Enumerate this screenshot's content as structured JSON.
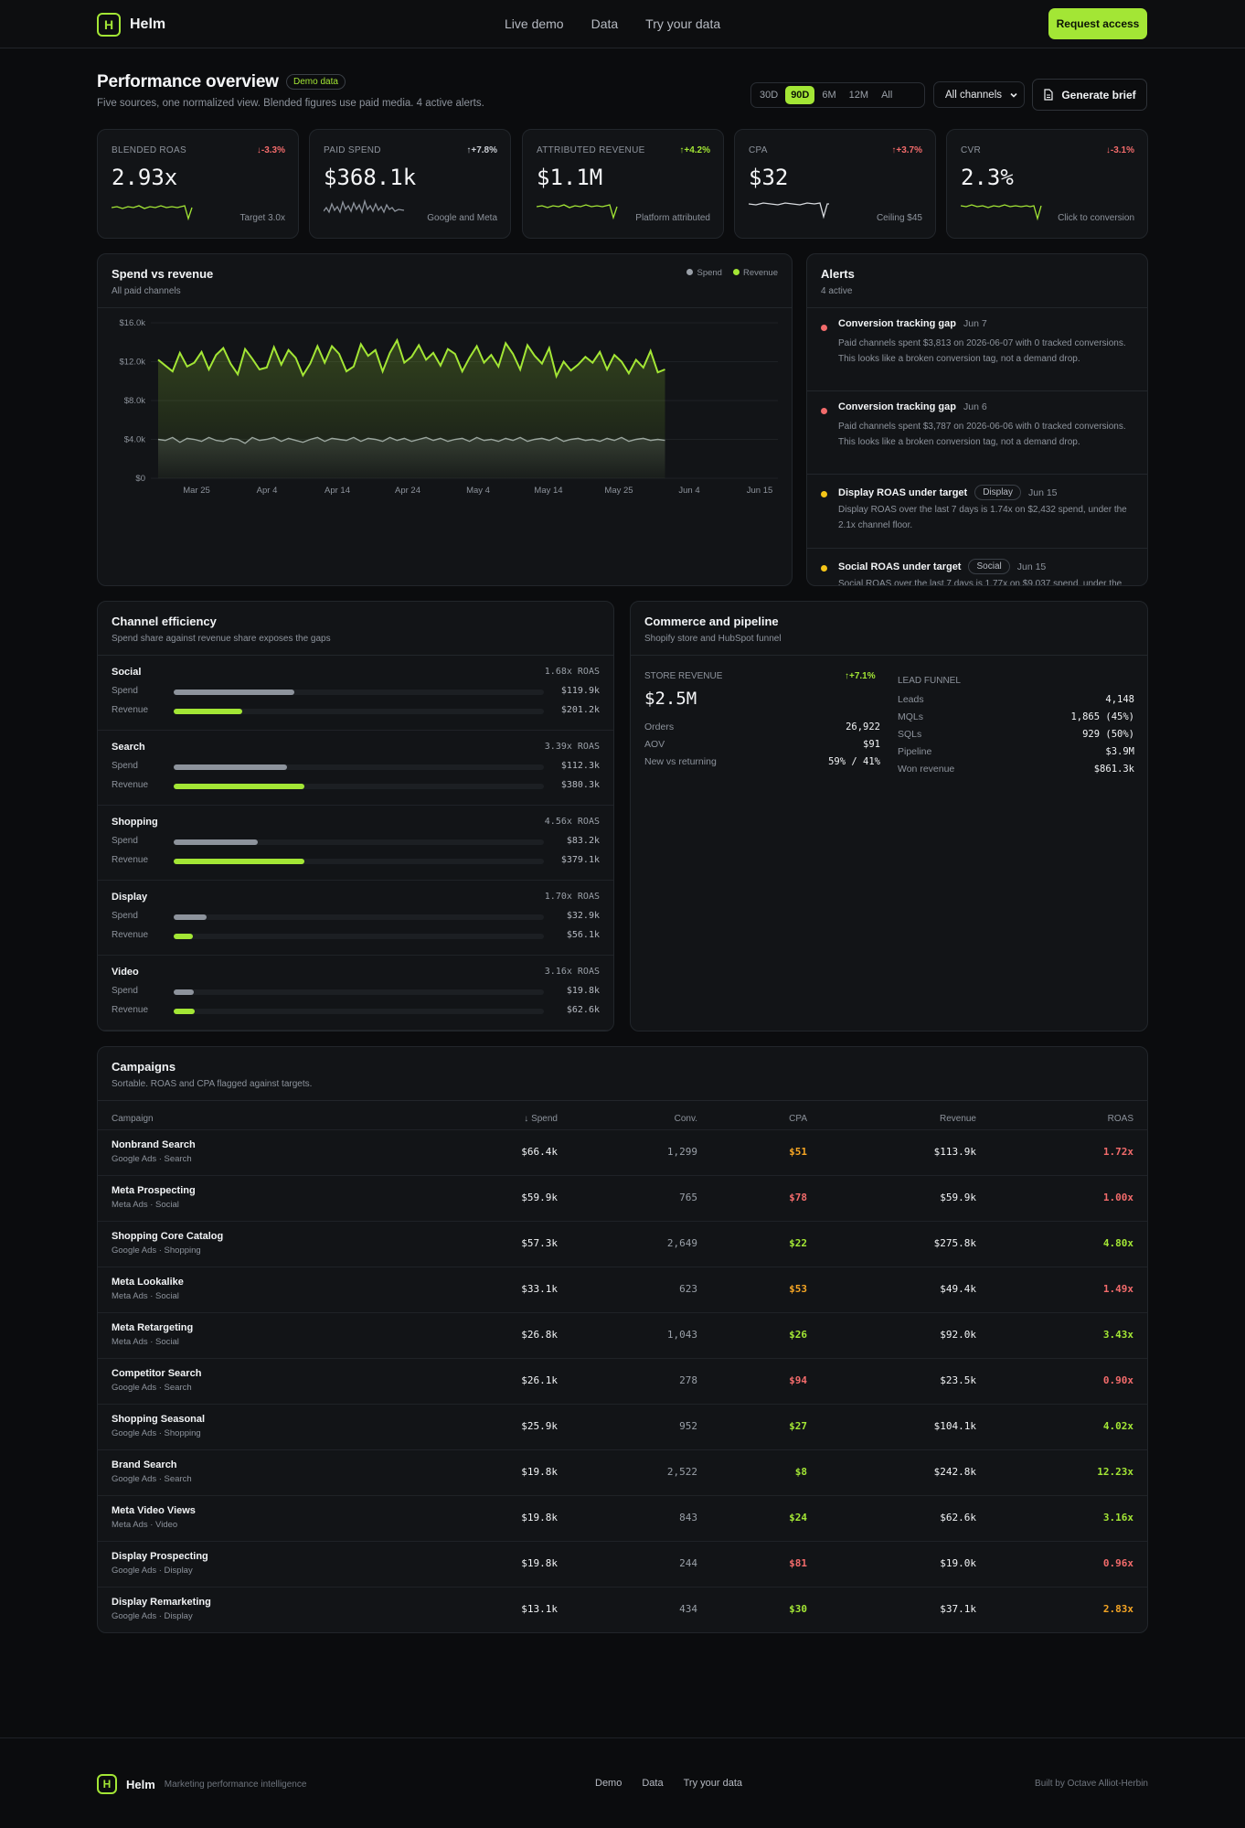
{
  "nav": {
    "brand": "Helm",
    "links": [
      "Live demo",
      "Data",
      "Try your data"
    ],
    "cta": "Request access"
  },
  "header": {
    "title": "Performance overview",
    "badge": "Demo data",
    "subtitle": "Five sources, one normalized view. Blended figures use paid media. 4 active alerts.",
    "ranges": [
      "30D",
      "90D",
      "6M",
      "12M",
      "All"
    ],
    "active_range": "90D",
    "channel_select": "All channels",
    "generate": "Generate brief"
  },
  "kpis": [
    {
      "label": "BLENDED ROAS",
      "delta": "↓-3.3%",
      "dir": "down",
      "value": "2.93x",
      "note": "Target 3.0x"
    },
    {
      "label": "PAID SPEND",
      "delta": "↑+7.8%",
      "dir": "neutral",
      "value": "$368.1k",
      "note": "Google and Meta"
    },
    {
      "label": "ATTRIBUTED REVENUE",
      "delta": "↑+4.2%",
      "dir": "up",
      "value": "$1.1M",
      "note": "Platform attributed"
    },
    {
      "label": "CPA",
      "delta": "↑+3.7%",
      "dir": "down",
      "value": "$32",
      "note": "Ceiling $45"
    },
    {
      "label": "CVR",
      "delta": "↓-3.1%",
      "dir": "down",
      "value": "2.3%",
      "note": "Click to conversion"
    }
  ],
  "spend_chart": {
    "title": "Spend vs revenue",
    "subtitle": "All paid channels",
    "legend": [
      "Spend",
      "Revenue"
    ]
  },
  "chart_data": {
    "type": "area",
    "title": "Spend vs revenue",
    "ylim": [
      0,
      16000
    ],
    "yticks": [
      "$16.0k",
      "$12.0k",
      "$8.0k",
      "$4.0k",
      "$0"
    ],
    "xticks": [
      "Mar 25",
      "Apr 4",
      "Apr 14",
      "Apr 24",
      "May 4",
      "May 14",
      "May 25",
      "Jun 4",
      "Jun 15"
    ],
    "series": [
      {
        "name": "Revenue",
        "color": "#a3e635",
        "values": [
          12200,
          11600,
          11000,
          12900,
          11500,
          11900,
          13000,
          11200,
          12700,
          13400,
          11800,
          10700,
          13300,
          12300,
          11200,
          11400,
          13500,
          11700,
          13200,
          12400,
          10600,
          11800,
          13600,
          11900,
          13600,
          12800,
          11000,
          11500,
          13800,
          12600,
          13200,
          11000,
          12900,
          14200,
          11900,
          12500,
          13700,
          12200,
          12900,
          11600,
          13300,
          12800,
          11000,
          12400,
          13600,
          11900,
          12700,
          11500,
          13900,
          12800,
          11200,
          13700,
          12600,
          11800,
          13400,
          10500,
          12000,
          11100,
          11700,
          12500,
          11900,
          13000,
          11200,
          12700,
          12000,
          10800,
          12200,
          11400,
          13100,
          10900,
          11200
        ]
      },
      {
        "name": "Spend",
        "color": "#9aa0a8",
        "values": [
          4000,
          3900,
          4200,
          3700,
          4100,
          4000,
          3800,
          4200,
          3900,
          3800,
          4100,
          4000,
          3600,
          4200,
          3900,
          4000,
          4200,
          3800,
          4100,
          3900,
          3700,
          4000,
          4200,
          3800,
          4100,
          4000,
          3900,
          4200,
          3800,
          4100,
          4000,
          3800,
          4200,
          3900,
          4100,
          3800,
          4000,
          4200,
          3900,
          4100,
          3800,
          4000,
          4100,
          3800,
          4200,
          3900,
          4000,
          3800,
          4100,
          3900,
          4200,
          3800,
          4000,
          4100,
          3900,
          4200,
          3800,
          4000,
          4100,
          3900,
          4000,
          3800,
          4100,
          3900,
          4200,
          3800,
          4000,
          4100,
          3900,
          4000,
          3900
        ]
      }
    ]
  },
  "alerts": {
    "title": "Alerts",
    "subtitle": "4 active",
    "items": [
      {
        "title": "Conversion tracking gap",
        "date": "Jun 7",
        "tag": "",
        "color": "#f26b6b",
        "body": "Paid channels spent $3,813 on 2026-06-07 with 0 tracked conversions. This looks like a broken conversion tag, not a demand drop."
      },
      {
        "title": "Conversion tracking gap",
        "date": "Jun 6",
        "tag": "",
        "color": "#f26b6b",
        "body": "Paid channels spent $3,787 on 2026-06-06 with 0 tracked conversions. This looks like a broken conversion tag, not a demand drop."
      },
      {
        "title": "Display ROAS under target",
        "date": "Jun 15",
        "tag": "Display",
        "color": "#f5c518",
        "body": "Display ROAS over the last 7 days is 1.74x on $2,432 spend, under the 2.1x channel floor."
      },
      {
        "title": "Social ROAS under target",
        "date": "Jun 15",
        "tag": "Social",
        "color": "#f5c518",
        "body": "Social ROAS over the last 7 days is 1.77x on $9,037 spend, under the"
      }
    ]
  },
  "channels": {
    "title": "Channel efficiency",
    "subtitle": "Spend share against revenue share exposes the gaps",
    "spend_label": "Spend",
    "revenue_label": "Revenue",
    "items": [
      {
        "name": "Social",
        "roas": "1.68x ROAS",
        "spend": "$119.9k",
        "revenue": "$201.2k",
        "spend_pct": 0.327,
        "rev_pct": 0.185
      },
      {
        "name": "Search",
        "roas": "3.39x ROAS",
        "spend": "$112.3k",
        "revenue": "$380.3k",
        "spend_pct": 0.305,
        "rev_pct": 0.353
      },
      {
        "name": "Shopping",
        "roas": "4.56x ROAS",
        "spend": "$83.2k",
        "revenue": "$379.1k",
        "spend_pct": 0.226,
        "rev_pct": 0.352
      },
      {
        "name": "Display",
        "roas": "1.70x ROAS",
        "spend": "$32.9k",
        "revenue": "$56.1k",
        "spend_pct": 0.089,
        "rev_pct": 0.052
      },
      {
        "name": "Video",
        "roas": "3.16x ROAS",
        "spend": "$19.8k",
        "revenue": "$62.6k",
        "spend_pct": 0.054,
        "rev_pct": 0.058
      }
    ]
  },
  "commerce": {
    "title": "Commerce and pipeline",
    "subtitle": "Shopify store and HubSpot funnel",
    "store_label": "STORE REVENUE",
    "store_delta": "↑+7.1%",
    "store_value": "$2.5M",
    "store_rows": [
      {
        "k": "Orders",
        "v": "26,922"
      },
      {
        "k": "AOV",
        "v": "$91"
      },
      {
        "k": "New vs returning",
        "v": "59% / 41%"
      }
    ],
    "funnel_label": "LEAD FUNNEL",
    "funnel_rows": [
      {
        "k": "Leads",
        "v": "4,148"
      },
      {
        "k": "MQLs",
        "v": "1,865 (45%)"
      },
      {
        "k": "SQLs",
        "v": "929 (50%)"
      },
      {
        "k": "Pipeline",
        "v": "$3.9M"
      },
      {
        "k": "Won revenue",
        "v": "$861.3k"
      }
    ]
  },
  "campaigns": {
    "title": "Campaigns",
    "subtitle": "Sortable. ROAS and CPA flagged against targets.",
    "headers": [
      "Campaign",
      "↓ Spend",
      "Conv.",
      "CPA",
      "Revenue",
      "ROAS"
    ],
    "rows": [
      {
        "name": "Nonbrand Search",
        "source": "Google Ads · Search",
        "spend": "$66.4k",
        "conv": "1,299",
        "cpa": "$51",
        "cpa_status": "warn",
        "revenue": "$113.9k",
        "roas": "1.72x",
        "roas_status": "bad"
      },
      {
        "name": "Meta Prospecting",
        "source": "Meta Ads · Social",
        "spend": "$59.9k",
        "conv": "765",
        "cpa": "$78",
        "cpa_status": "bad",
        "revenue": "$59.9k",
        "roas": "1.00x",
        "roas_status": "bad"
      },
      {
        "name": "Shopping Core Catalog",
        "source": "Google Ads · Shopping",
        "spend": "$57.3k",
        "conv": "2,649",
        "cpa": "$22",
        "cpa_status": "good",
        "revenue": "$275.8k",
        "roas": "4.80x",
        "roas_status": "good"
      },
      {
        "name": "Meta Lookalike",
        "source": "Meta Ads · Social",
        "spend": "$33.1k",
        "conv": "623",
        "cpa": "$53",
        "cpa_status": "warn",
        "revenue": "$49.4k",
        "roas": "1.49x",
        "roas_status": "bad"
      },
      {
        "name": "Meta Retargeting",
        "source": "Meta Ads · Social",
        "spend": "$26.8k",
        "conv": "1,043",
        "cpa": "$26",
        "cpa_status": "good",
        "revenue": "$92.0k",
        "roas": "3.43x",
        "roas_status": "good"
      },
      {
        "name": "Competitor Search",
        "source": "Google Ads · Search",
        "spend": "$26.1k",
        "conv": "278",
        "cpa": "$94",
        "cpa_status": "bad",
        "revenue": "$23.5k",
        "roas": "0.90x",
        "roas_status": "bad"
      },
      {
        "name": "Shopping Seasonal",
        "source": "Google Ads · Shopping",
        "spend": "$25.9k",
        "conv": "952",
        "cpa": "$27",
        "cpa_status": "good",
        "revenue": "$104.1k",
        "roas": "4.02x",
        "roas_status": "good"
      },
      {
        "name": "Brand Search",
        "source": "Google Ads · Search",
        "spend": "$19.8k",
        "conv": "2,522",
        "cpa": "$8",
        "cpa_status": "good",
        "revenue": "$242.8k",
        "roas": "12.23x",
        "roas_status": "good"
      },
      {
        "name": "Meta Video Views",
        "source": "Meta Ads · Video",
        "spend": "$19.8k",
        "conv": "843",
        "cpa": "$24",
        "cpa_status": "good",
        "revenue": "$62.6k",
        "roas": "3.16x",
        "roas_status": "good"
      },
      {
        "name": "Display Prospecting",
        "source": "Google Ads · Display",
        "spend": "$19.8k",
        "conv": "244",
        "cpa": "$81",
        "cpa_status": "bad",
        "revenue": "$19.0k",
        "roas": "0.96x",
        "roas_status": "bad"
      },
      {
        "name": "Display Remarketing",
        "source": "Google Ads · Display",
        "spend": "$13.1k",
        "conv": "434",
        "cpa": "$30",
        "cpa_status": "good",
        "revenue": "$37.1k",
        "roas": "2.83x",
        "roas_status": "warn"
      }
    ]
  },
  "footer": {
    "brand": "Helm",
    "tagline": "Marketing performance intelligence",
    "links": [
      "Demo",
      "Data",
      "Try your data"
    ],
    "credit": "Built by Octave Alliot-Herbin"
  },
  "colors": {
    "accent": "#a3e635",
    "bad": "#f26b6b",
    "warn": "#f5a524",
    "neutral": "#9aa0a8"
  }
}
